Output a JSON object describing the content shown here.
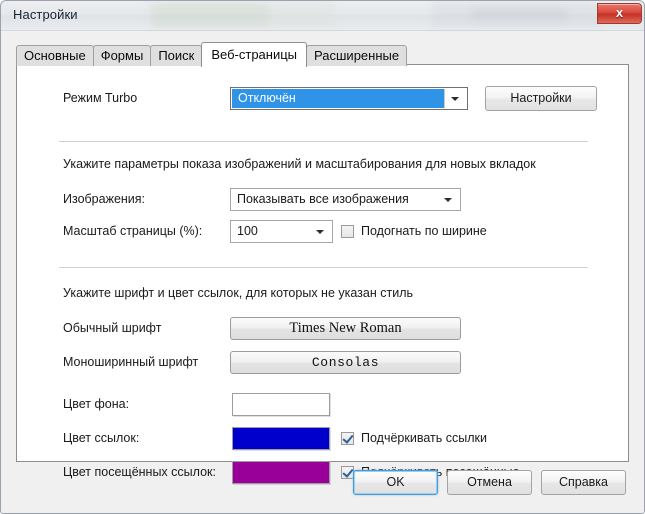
{
  "window": {
    "title": "Настройки",
    "close_label": "x"
  },
  "tabs": [
    {
      "label": "Основные",
      "active": false
    },
    {
      "label": "Формы",
      "active": false
    },
    {
      "label": "Поиск",
      "active": false
    },
    {
      "label": "Веб-страницы",
      "active": true
    },
    {
      "label": "Расширенные",
      "active": false
    }
  ],
  "turbo": {
    "label": "Режим Turbo",
    "value": "Отключён",
    "settings_button": "Настройки"
  },
  "images_section": {
    "note": "Укажите параметры показа изображений и масштабирования для новых вкладок",
    "images_label": "Изображения:",
    "images_value": "Показывать все изображения",
    "zoom_label": "Масштаб страницы (%):",
    "zoom_value": "100",
    "fit_width_label": "Подогнать по ширине",
    "fit_width_checked": false
  },
  "fonts_section": {
    "note": "Укажите шрифт и цвет ссылок, для которых не указан стиль",
    "normal_font_label": "Обычный шрифт",
    "normal_font_value": "Times New Roman",
    "mono_font_label": "Моноширинный шрифт",
    "mono_font_value": "Consolas"
  },
  "colors_section": {
    "background_label": "Цвет фона:",
    "background_color": "#ffffff",
    "link_label": "Цвет ссылок:",
    "link_color": "#0000cc",
    "visited_label": "Цвет посещённых ссылок:",
    "visited_color": "#990099",
    "underline_links_label": "Подчёркивать ссылки",
    "underline_links_checked": true,
    "underline_visited_label": "Подчёркивать посещённые",
    "underline_visited_checked": true
  },
  "footer": {
    "ok": "OK",
    "cancel": "Отмена",
    "help": "Справка"
  }
}
